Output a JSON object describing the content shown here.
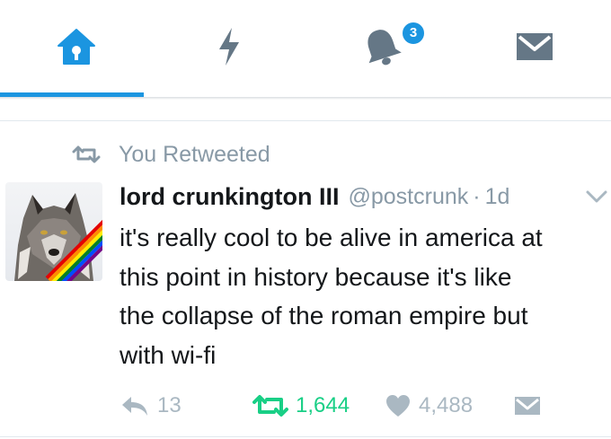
{
  "tabs": [
    {
      "name": "home",
      "icon": "home-icon",
      "active": true
    },
    {
      "name": "moments",
      "icon": "lightning-icon",
      "active": false
    },
    {
      "name": "notifications",
      "icon": "bell-icon",
      "active": false,
      "badge": "3"
    },
    {
      "name": "messages",
      "icon": "envelope-icon",
      "active": false
    }
  ],
  "colors": {
    "accent": "#1b95e0",
    "icon_inactive": "#657786",
    "secondary_text": "#8899a6",
    "retweet_green": "#19cf86",
    "action_gray": "#aab8c2",
    "text": "#14171a"
  },
  "tweet": {
    "retweet_context": "You Retweeted",
    "author": {
      "display_name": "lord crunkington III",
      "handle": "@postcrunk",
      "avatar": "wolf-avatar-with-rainbow-stripe"
    },
    "separator": "·",
    "timestamp": "1d",
    "text": "it's really cool to be alive in america at\nthis point in history because it's like\nthe collapse of the roman empire but\nwith wi-fi",
    "actions": {
      "reply_count": "13",
      "retweet_count": "1,644",
      "like_count": "4,488",
      "retweeted": true
    }
  }
}
